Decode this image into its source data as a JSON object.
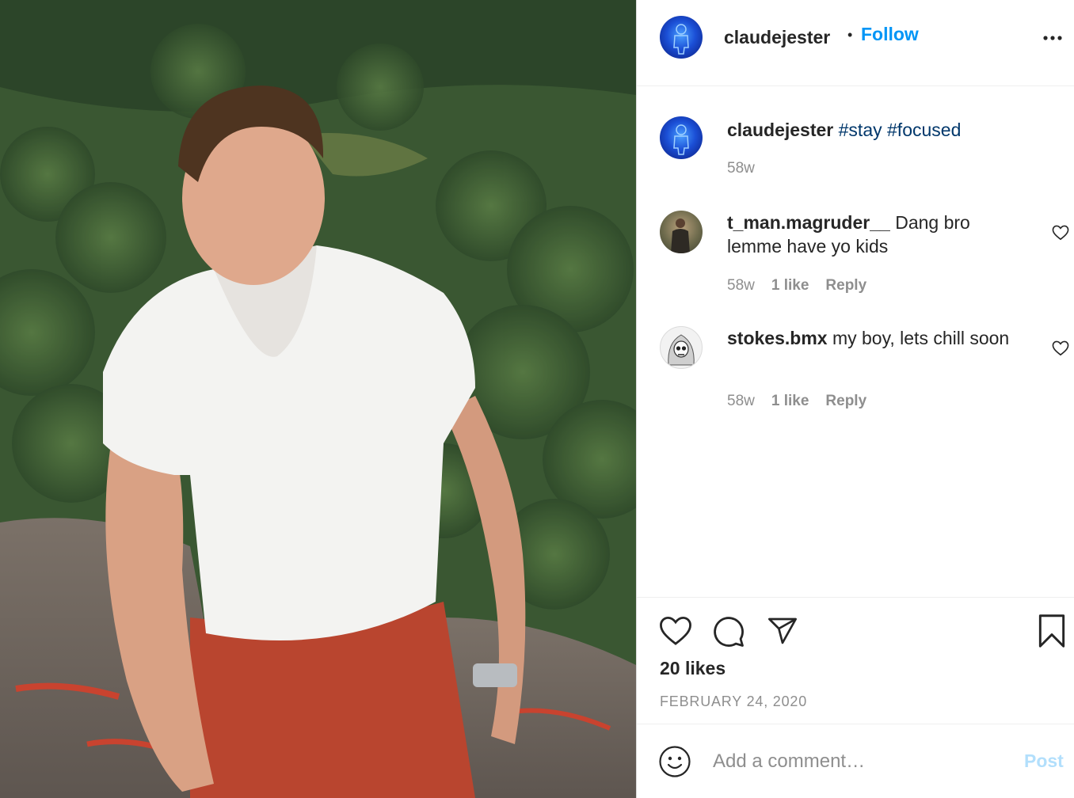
{
  "post": {
    "author": "claudejester",
    "separator": "•",
    "follow_label": "Follow",
    "more_icon": "more-horizontal-icon"
  },
  "caption": {
    "user": "claudejester",
    "tags": [
      "#stay",
      "#focused"
    ],
    "age": "58w"
  },
  "comments": [
    {
      "user": "t_man.magruder__",
      "text": "Dang bro lemme have yo kids",
      "age": "58w",
      "likes": "1 like",
      "reply_label": "Reply"
    },
    {
      "user": "stokes.bmx",
      "text": "my boy, lets chill soon",
      "age": "58w",
      "likes": "1 like",
      "reply_label": "Reply"
    }
  ],
  "actions": {
    "like_icon": "heart-icon",
    "comment_icon": "comment-bubble-icon",
    "share_icon": "paper-plane-icon",
    "save_icon": "bookmark-icon"
  },
  "likes_count": "20 likes",
  "date": "FEBRUARY 24, 2020",
  "add_comment": {
    "placeholder": "Add a comment…",
    "post_label": "Post"
  },
  "colors": {
    "link_blue": "#0095f6",
    "hashtag_blue": "#00376b",
    "muted_text": "#8e8e8e",
    "post_disabled": "#b2dffc"
  }
}
